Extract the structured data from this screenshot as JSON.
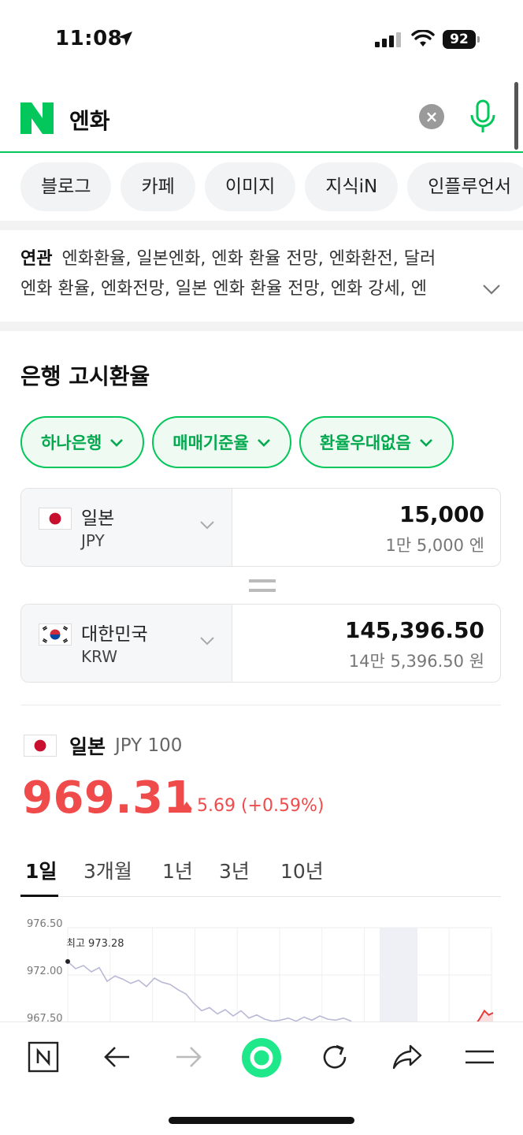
{
  "status_bar": {
    "time": "11:08",
    "battery": "92"
  },
  "search": {
    "query": "엔화"
  },
  "categories": [
    "블로그",
    "카페",
    "이미지",
    "지식iN",
    "인플루언서"
  ],
  "related": {
    "label": "연관",
    "line1": "엔화환율, 일본엔화, 엔화 환율 전망, 엔화환전, 달러",
    "line2": "엔화 환율, 엔화전망, 일본 엔화 환율 전망, 엔화 강세, 엔"
  },
  "exchange": {
    "title": "은행 고시환율",
    "filters": [
      "하나은행",
      "매매기준율",
      "환율우대없음"
    ],
    "from": {
      "name": "일본",
      "code": "JPY",
      "amount": "15,000",
      "amount_words": "1만 5,000 엔"
    },
    "to": {
      "name": "대한민국",
      "code": "KRW",
      "amount": "145,396.50",
      "amount_words": "14만 5,396.50 원"
    }
  },
  "rate": {
    "country": "일본",
    "unit": "JPY 100",
    "value": "969.31",
    "change": "5.69 (+0.59%)",
    "direction": "up",
    "up_color": "#f04b4b"
  },
  "periods": [
    "1일",
    "3개월",
    "1년",
    "3년",
    "10년"
  ],
  "active_period": "1일",
  "chart_data": {
    "type": "line",
    "yticks": [
      "976.50",
      "972.00",
      "967.50"
    ],
    "ylim": [
      967.5,
      976.5
    ],
    "max_label": "최고 973.28",
    "y": [
      973.28,
      972.6,
      972.9,
      972.3,
      972.7,
      971.4,
      971.9,
      971.6,
      971.2,
      971.5,
      970.9,
      971.7,
      971.3,
      971.1,
      970.6,
      970.2,
      969.3,
      968.6,
      968.9,
      968.3,
      968.7,
      968.1,
      968.6,
      967.9,
      968.2,
      967.8,
      967.6,
      967.7,
      967.9,
      967.6,
      968.0,
      967.7,
      968.1,
      967.8,
      967.7,
      967.9,
      967.6
    ],
    "recent_y": [
      967.3,
      967.9,
      968.6,
      968.2,
      968.4
    ],
    "line_color": "#b9b9d6",
    "recent_color": "#e23b3b"
  },
  "toolbar": [
    "naver-home",
    "back",
    "forward",
    "green-dot",
    "reload",
    "share",
    "menu"
  ]
}
